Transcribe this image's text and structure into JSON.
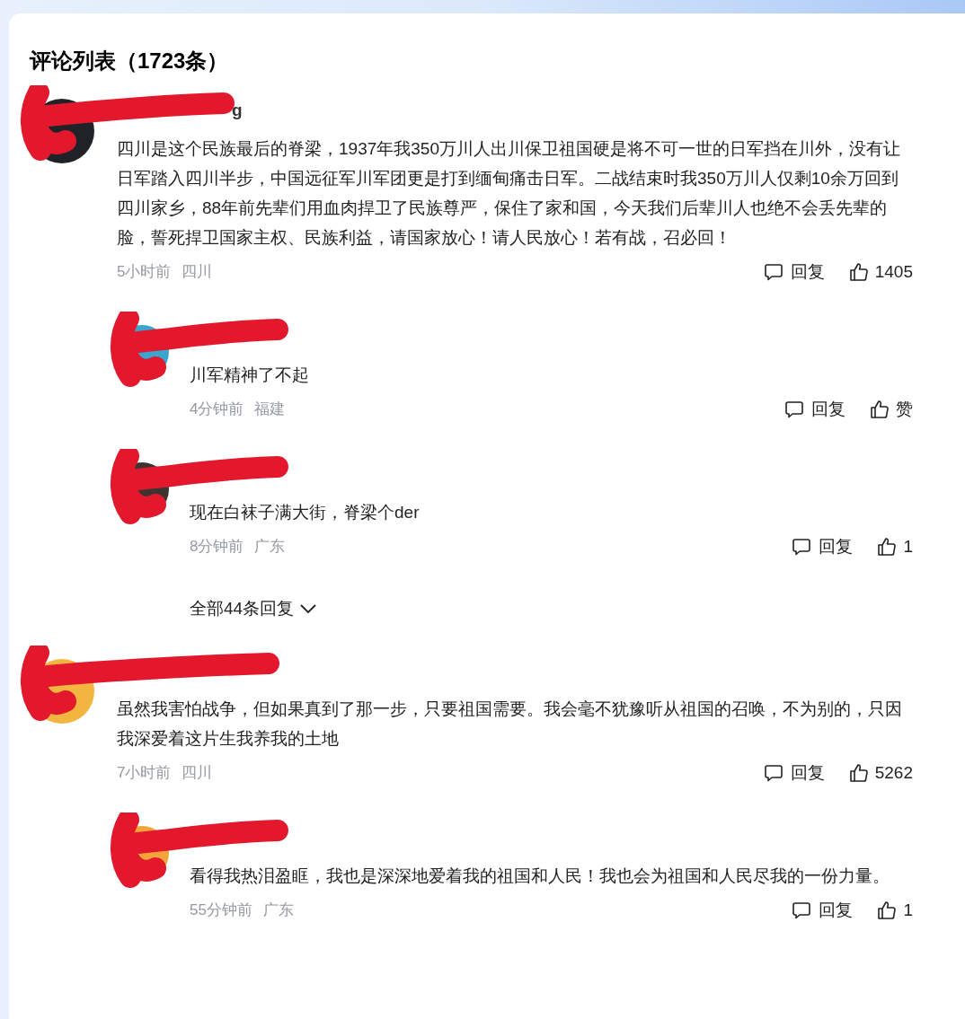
{
  "title": "评论列表（1723条）",
  "comments": [
    {
      "name": "g",
      "redacted": true,
      "text": "四川是这个民族最后的脊梁，1937年我350万川人出川保卫祖国硬是将不可一世的日军挡在川外，没有让日军踏入四川半步，中国远征军川军团更是打到缅甸痛击日军。二战结束时我350万川人仅剩10余万回到四川家乡，88年前先辈们用血肉捍卫了民族尊严，保住了家和国，今天我们后辈川人也绝不会丢先辈的脸，誓死捍卫国家主权、民族利益，请国家放心！请人民放心！若有战，召必回！",
      "time": "5小时前",
      "location": "四川",
      "reply_label": "回复",
      "likes": "1405",
      "replies": [
        {
          "redacted": true,
          "text": "川军精神了不起",
          "time": "4分钟前",
          "location": "福建",
          "reply_label": "回复",
          "likes": "赞"
        },
        {
          "redacted": true,
          "text": "现在白袜子满大街，脊梁个der",
          "time": "8分钟前",
          "location": "广东",
          "reply_label": "回复",
          "likes": "1"
        }
      ],
      "more_replies": "全部44条回复"
    },
    {
      "redacted": true,
      "text": "虽然我害怕战争，但如果真到了那一步，只要祖国需要。我会毫不犹豫听从祖国的召唤，不为别的，只因我深爱着这片生我养我的土地",
      "time": "7小时前",
      "location": "四川",
      "reply_label": "回复",
      "likes": "5262",
      "replies": [
        {
          "redacted": true,
          "text": "看得我热泪盈眶，我也是深深地爱着我的祖国和人民！我也会为祖国和人民尽我的一份力量。",
          "time": "55分钟前",
          "location": "广东",
          "reply_label": "回复",
          "likes": "1"
        }
      ]
    }
  ]
}
